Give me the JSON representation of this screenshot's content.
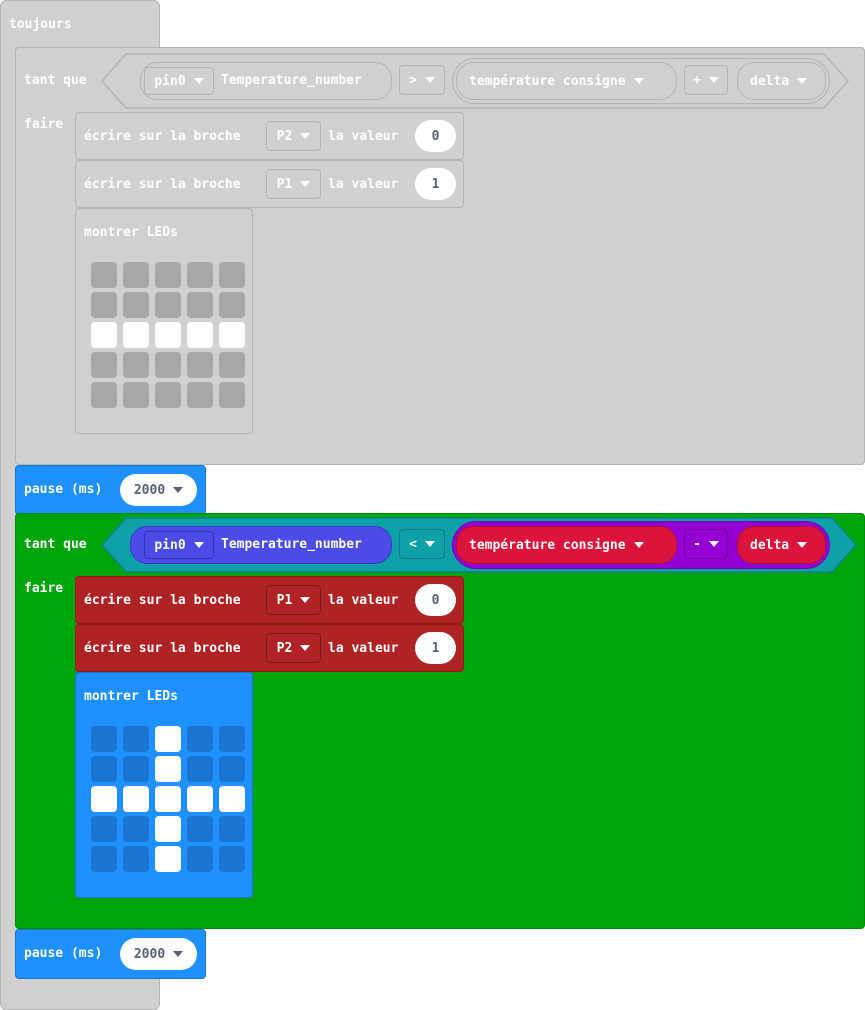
{
  "forever": {
    "label": "toujours"
  },
  "loop1": {
    "while_label": "tant que",
    "do_label": "faire",
    "condition": {
      "pin": "pin0",
      "variable": "Temperature_number",
      "operator": ">",
      "setpoint": "température consigne",
      "arith_op": "+",
      "delta": "delta"
    },
    "stmt1": {
      "text": "écrire sur la broche",
      "pin": "P2",
      "value_label": "la valeur",
      "value": "0"
    },
    "stmt2": {
      "text": "écrire sur la broche",
      "pin": "P1",
      "value_label": "la valeur",
      "value": "1"
    },
    "leds": {
      "label": "montrer LEDs",
      "grid": [
        [
          0,
          0,
          0,
          0,
          0
        ],
        [
          0,
          0,
          0,
          0,
          0
        ],
        [
          1,
          1,
          1,
          1,
          1
        ],
        [
          0,
          0,
          0,
          0,
          0
        ],
        [
          0,
          0,
          0,
          0,
          0
        ]
      ]
    }
  },
  "pause1": {
    "label": "pause (ms)",
    "value": "2000"
  },
  "loop2": {
    "while_label": "tant que",
    "do_label": "faire",
    "condition": {
      "pin": "pin0",
      "variable": "Temperature_number",
      "operator": "<",
      "setpoint": "température consigne",
      "arith_op": "-",
      "delta": "delta"
    },
    "stmt1": {
      "text": "écrire sur la broche",
      "pin": "P1",
      "value_label": "la valeur",
      "value": "0"
    },
    "stmt2": {
      "text": "écrire sur la broche",
      "pin": "P2",
      "value_label": "la valeur",
      "value": "1"
    },
    "leds": {
      "label": "montrer LEDs",
      "grid": [
        [
          0,
          0,
          1,
          0,
          0
        ],
        [
          0,
          0,
          1,
          0,
          0
        ],
        [
          1,
          1,
          1,
          1,
          1
        ],
        [
          0,
          0,
          1,
          0,
          0
        ],
        [
          0,
          0,
          1,
          0,
          0
        ]
      ]
    }
  },
  "pause2": {
    "label": "pause (ms)",
    "value": "2000"
  },
  "colors": {
    "disabled": "#d0d0d0",
    "disabled_border": "#b4b4b4",
    "loop_green": "#00a40b",
    "pause_blue": "#1e90ff",
    "pins_red": "#b02324",
    "input_blue": "#4b4be8",
    "compare_teal": "#0fa1a8",
    "setpoint_crimson": "#dc143c",
    "math_purple": "#9400d3",
    "led_off_grey": "#a8a8a8",
    "led_off_blue": "#1a74d2",
    "led_on": "#ffffff"
  }
}
